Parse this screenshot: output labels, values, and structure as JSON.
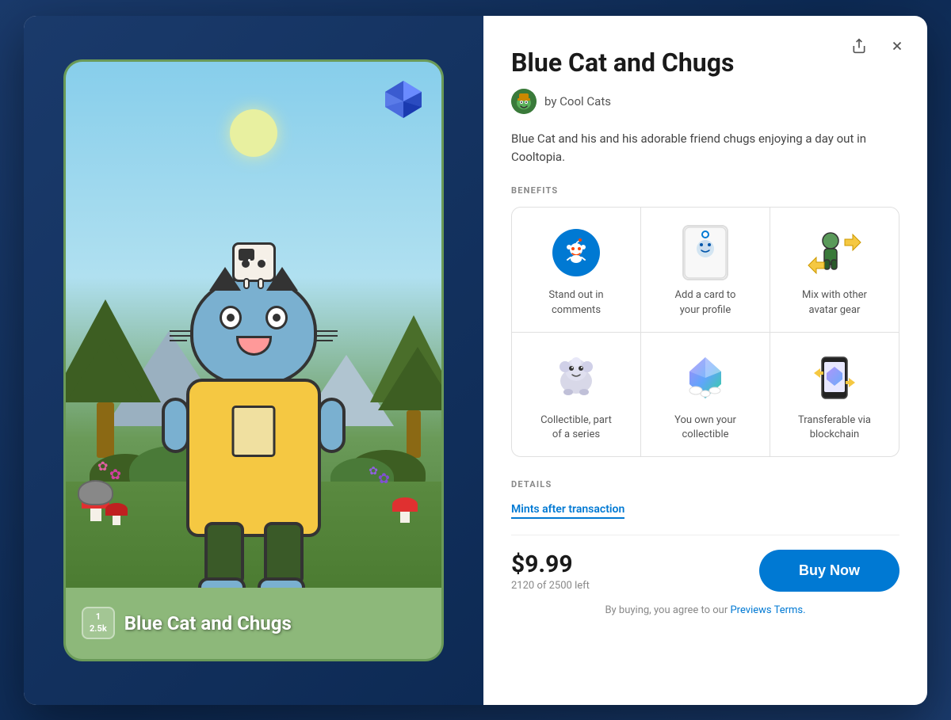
{
  "modal": {
    "title": "Blue Cat and Chugs",
    "creator": {
      "name": "Cool Cats",
      "avatar_emoji": "🐱"
    },
    "description": "Blue Cat and his and his adorable friend chugs enjoying a day out in Cooltopia.",
    "benefits_label": "BENEFITS",
    "benefits": [
      {
        "id": "stand-out",
        "label": "Stand out in comments",
        "icon_type": "reddit-blue"
      },
      {
        "id": "add-card",
        "label": "Add a card to your profile",
        "icon_type": "reddit-card"
      },
      {
        "id": "mix-gear",
        "label": "Mix with other avatar gear",
        "icon_type": "avatar-gear"
      },
      {
        "id": "collectible-series",
        "label": "Collectible, part of a series",
        "icon_type": "collectible-series"
      },
      {
        "id": "own-collectible",
        "label": "You own your collectible",
        "icon_type": "gem"
      },
      {
        "id": "blockchain",
        "label": "Transferable via blockchain",
        "icon_type": "blockchain"
      }
    ],
    "details_label": "DETAILS",
    "mints_badge": "Mints after transaction",
    "price": "$9.99",
    "stock_current": "2120",
    "stock_total": "2500",
    "stock_label": "of 2500 left",
    "buy_button_label": "Buy Now",
    "terms_prefix": "By buying, you agree to our ",
    "terms_link": "Previews Terms.",
    "share_icon": "↑",
    "close_icon": "✕",
    "card": {
      "name": "Blue Cat and Chugs",
      "badge_top": "1",
      "badge_bottom": "2.5k"
    }
  }
}
